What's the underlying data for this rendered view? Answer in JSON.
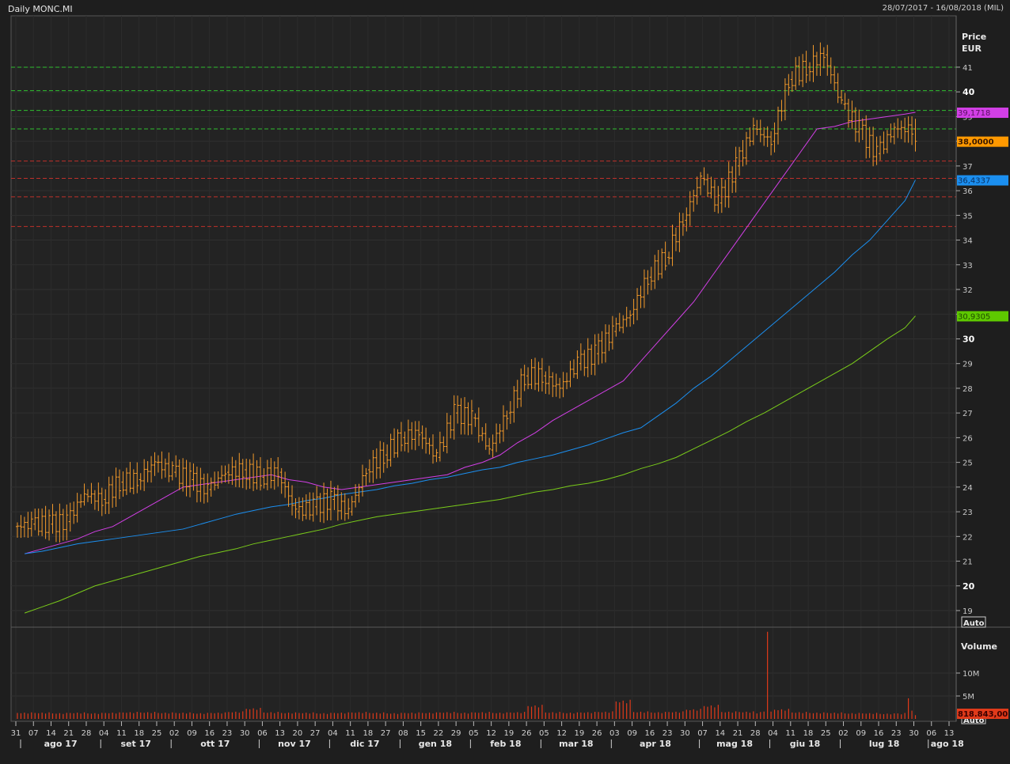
{
  "header": {
    "title": "Daily MONC.MI",
    "date_range": "28/07/2017 - 16/08/2018 (MIL)"
  },
  "price_panel": {
    "axis_title_1": "Price",
    "axis_title_2": "EUR",
    "auto_label": "Auto"
  },
  "volume_panel": {
    "axis_title": "Volume",
    "ticks": [
      {
        "label": "10M",
        "value": 10
      },
      {
        "label": "5M",
        "value": 5
      }
    ],
    "last_label": "818.843,00",
    "auto_label": "Auto",
    "color": "#e03a1a"
  },
  "badges": {
    "ma_magenta": {
      "label": "39,1718",
      "color": "#d23fe6"
    },
    "last_price": {
      "label": "38,0000",
      "color": "#ff9900"
    },
    "ma_blue": {
      "label": "36,4337",
      "color": "#1b8ff0"
    },
    "ma_green": {
      "label": "30,9305",
      "color": "#5ec800"
    }
  },
  "chart_data": {
    "type": "ohlc",
    "x_ticks": [
      "31",
      "07",
      "14",
      "21",
      "28",
      "04",
      "11",
      "18",
      "25",
      "02",
      "09",
      "16",
      "23",
      "30",
      "06",
      "13",
      "20",
      "27",
      "04",
      "11",
      "18",
      "27",
      "08",
      "15",
      "22",
      "29",
      "05",
      "12",
      "19",
      "26",
      "05",
      "12",
      "19",
      "26",
      "03",
      "09",
      "16",
      "23",
      "30",
      "07",
      "14",
      "21",
      "28",
      "04",
      "11",
      "18",
      "25",
      "02",
      "09",
      "16",
      "23",
      "30",
      "06",
      "13"
    ],
    "months": [
      {
        "label": "ago 17",
        "first_tick": 0
      },
      {
        "label": "set 17",
        "first_tick": 5
      },
      {
        "label": "ott 17",
        "first_tick": 9
      },
      {
        "label": "nov 17",
        "first_tick": 14
      },
      {
        "label": "dic 17",
        "first_tick": 18
      },
      {
        "label": "gen 18",
        "first_tick": 22
      },
      {
        "label": "feb 18",
        "first_tick": 26
      },
      {
        "label": "mar 18",
        "first_tick": 30
      },
      {
        "label": "apr 18",
        "first_tick": 34
      },
      {
        "label": "mag 18",
        "first_tick": 39
      },
      {
        "label": "giu 18",
        "first_tick": 43
      },
      {
        "label": "lug 18",
        "first_tick": 47
      },
      {
        "label": "ago 18",
        "first_tick": 52
      }
    ],
    "y_ticks": [
      19,
      20,
      21,
      22,
      23,
      24,
      25,
      26,
      27,
      28,
      29,
      30,
      31,
      32,
      33,
      34,
      35,
      36,
      37,
      38,
      39,
      40,
      41
    ],
    "ylim": [
      19,
      41
    ],
    "weekly_close": [
      22.5,
      22.5,
      22.6,
      23.7,
      23.5,
      24.2,
      24.3,
      25.0,
      24.6,
      24.3,
      23.9,
      24.6,
      24.7,
      24.4,
      24.6,
      23.0,
      23.2,
      23.5,
      23.0,
      24.7,
      25.3,
      26.0,
      26.2,
      25.2,
      27.0,
      26.8,
      25.5,
      27.0,
      28.5,
      28.5,
      28.0,
      29.0,
      29.4,
      30.3,
      31.0,
      32.5,
      33.3,
      34.8,
      36.5,
      35.5,
      37.0,
      38.5,
      38.0,
      40.5,
      41.0,
      41.5,
      39.5,
      38.5,
      37.5,
      38.5,
      38.5,
      38.0
    ],
    "bar_color": "#f39a2b",
    "moving_averages": [
      {
        "color": "#d23fe6",
        "values": [
          21.3,
          21.5,
          21.7,
          21.9,
          22.2,
          22.4,
          22.8,
          23.2,
          23.6,
          24.0,
          24.1,
          24.2,
          24.3,
          24.4,
          24.5,
          24.3,
          24.2,
          24.0,
          23.9,
          24.0,
          24.1,
          24.2,
          24.3,
          24.4,
          24.5,
          24.8,
          25.0,
          25.3,
          25.8,
          26.2,
          26.7,
          27.1,
          27.5,
          27.9,
          28.3,
          29.1,
          29.9,
          30.7,
          31.5,
          32.5,
          33.5,
          34.5,
          35.5,
          36.5,
          37.5,
          38.5,
          38.6,
          38.8,
          38.9,
          39.0,
          39.1,
          39.1718
        ]
      },
      {
        "color": "#1b8ff0",
        "values": [
          21.3,
          21.4,
          21.55,
          21.7,
          21.8,
          21.9,
          22.0,
          22.1,
          22.2,
          22.3,
          22.5,
          22.7,
          22.9,
          23.05,
          23.2,
          23.3,
          23.45,
          23.55,
          23.7,
          23.8,
          23.9,
          24.05,
          24.15,
          24.3,
          24.4,
          24.55,
          24.7,
          24.8,
          25.0,
          25.15,
          25.3,
          25.5,
          25.7,
          25.95,
          26.2,
          26.4,
          26.9,
          27.4,
          28.0,
          28.5,
          29.1,
          29.7,
          30.3,
          30.9,
          31.5,
          32.1,
          32.7,
          33.4,
          34.0,
          34.8,
          35.6,
          36.4337
        ]
      },
      {
        "color": "#7acc1a",
        "values": [
          18.9,
          19.15,
          19.4,
          19.7,
          20.0,
          20.2,
          20.4,
          20.6,
          20.8,
          21.0,
          21.2,
          21.35,
          21.5,
          21.7,
          21.85,
          22.0,
          22.15,
          22.3,
          22.5,
          22.65,
          22.8,
          22.9,
          23.0,
          23.1,
          23.2,
          23.3,
          23.4,
          23.5,
          23.65,
          23.8,
          23.9,
          24.05,
          24.15,
          24.3,
          24.5,
          24.75,
          24.95,
          25.2,
          25.55,
          25.9,
          26.25,
          26.65,
          27.0,
          27.4,
          27.8,
          28.2,
          28.6,
          29.0,
          29.5,
          30.0,
          30.45,
          30.9305
        ]
      }
    ],
    "levels": {
      "green": {
        "color": "#2fbf2f",
        "values": [
          41.0,
          40.05,
          39.25,
          38.5
        ]
      },
      "red": {
        "color": "#c0302a",
        "values": [
          37.2,
          36.5,
          35.75,
          34.55
        ]
      }
    },
    "volume_m_weekly": [
      1.3,
      1.3,
      1.2,
      1.3,
      1.2,
      1.3,
      1.4,
      1.4,
      1.3,
      1.3,
      1.2,
      1.3,
      1.5,
      2.2,
      1.4,
      1.3,
      1.3,
      1.2,
      1.3,
      1.4,
      1.3,
      1.2,
      1.3,
      1.3,
      1.4,
      1.3,
      1.4,
      1.3,
      1.4,
      2.8,
      1.4,
      1.3,
      1.4,
      1.5,
      3.8,
      1.5,
      1.4,
      1.5,
      2.0,
      2.8,
      1.5,
      1.5,
      [
        1.2,
        1.5,
        1.6,
        19.0,
        1.6
      ],
      2.0,
      1.4,
      1.3,
      1.3,
      1.2,
      1.2,
      1.1,
      [
        1.2,
        1.0,
        1.3,
        4.5,
        1.8
      ],
      [
        0.82
      ]
    ]
  }
}
